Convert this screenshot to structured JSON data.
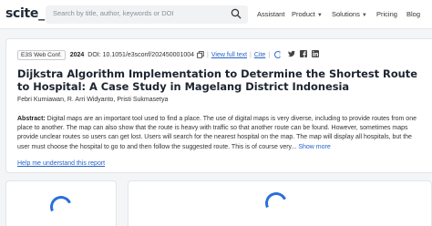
{
  "header": {
    "logo": "scite_",
    "search_placeholder": "Search by title, author, keywords or DOI",
    "nav": [
      {
        "label": "Assistant",
        "has_caret": false
      },
      {
        "label": "Product",
        "has_caret": true
      },
      {
        "label": "Solutions",
        "has_caret": true
      },
      {
        "label": "Pricing",
        "has_caret": false
      },
      {
        "label": "Blog",
        "has_caret": false
      }
    ]
  },
  "paper": {
    "source_badge": "E3S Web Conf.",
    "year": "2024",
    "doi": "DOI: 10.1051/e3sconf/202450001004",
    "view_full_text": "View full text",
    "cite": "Cite",
    "title": "Dijkstra Algorithm Implementation to Determine the Shortest Route to Hospital: A Case Study in Magelang District Indonesia",
    "authors": "Febri Kurniawan, R. Arri Widyanto, Pristi Sukmasetya",
    "abstract_label": "Abstract:",
    "abstract_text": " Digital maps are an important tool used to find a place. The use of digital maps is very diverse, including to provide routes from one place to another. The map can also show that the route is heavy with traffic so that another route can be found. However, sometimes maps provide unclear routes so users can get lost. Users will search for the nearest hospital on the map. The map will display all hospitals, but the user must choose the hospital to go to and then follow the suggested route. This is of course very... ",
    "show_more": "Show more",
    "help_link": "Help me understand this report"
  },
  "colors": {
    "accent": "#2563c9",
    "spinner": "#2a6fdb",
    "background": "#f4f5f7"
  },
  "icons": [
    "search-icon",
    "copy-icon",
    "loading-spinner",
    "twitter-icon",
    "facebook-icon",
    "linkedin-icon"
  ]
}
